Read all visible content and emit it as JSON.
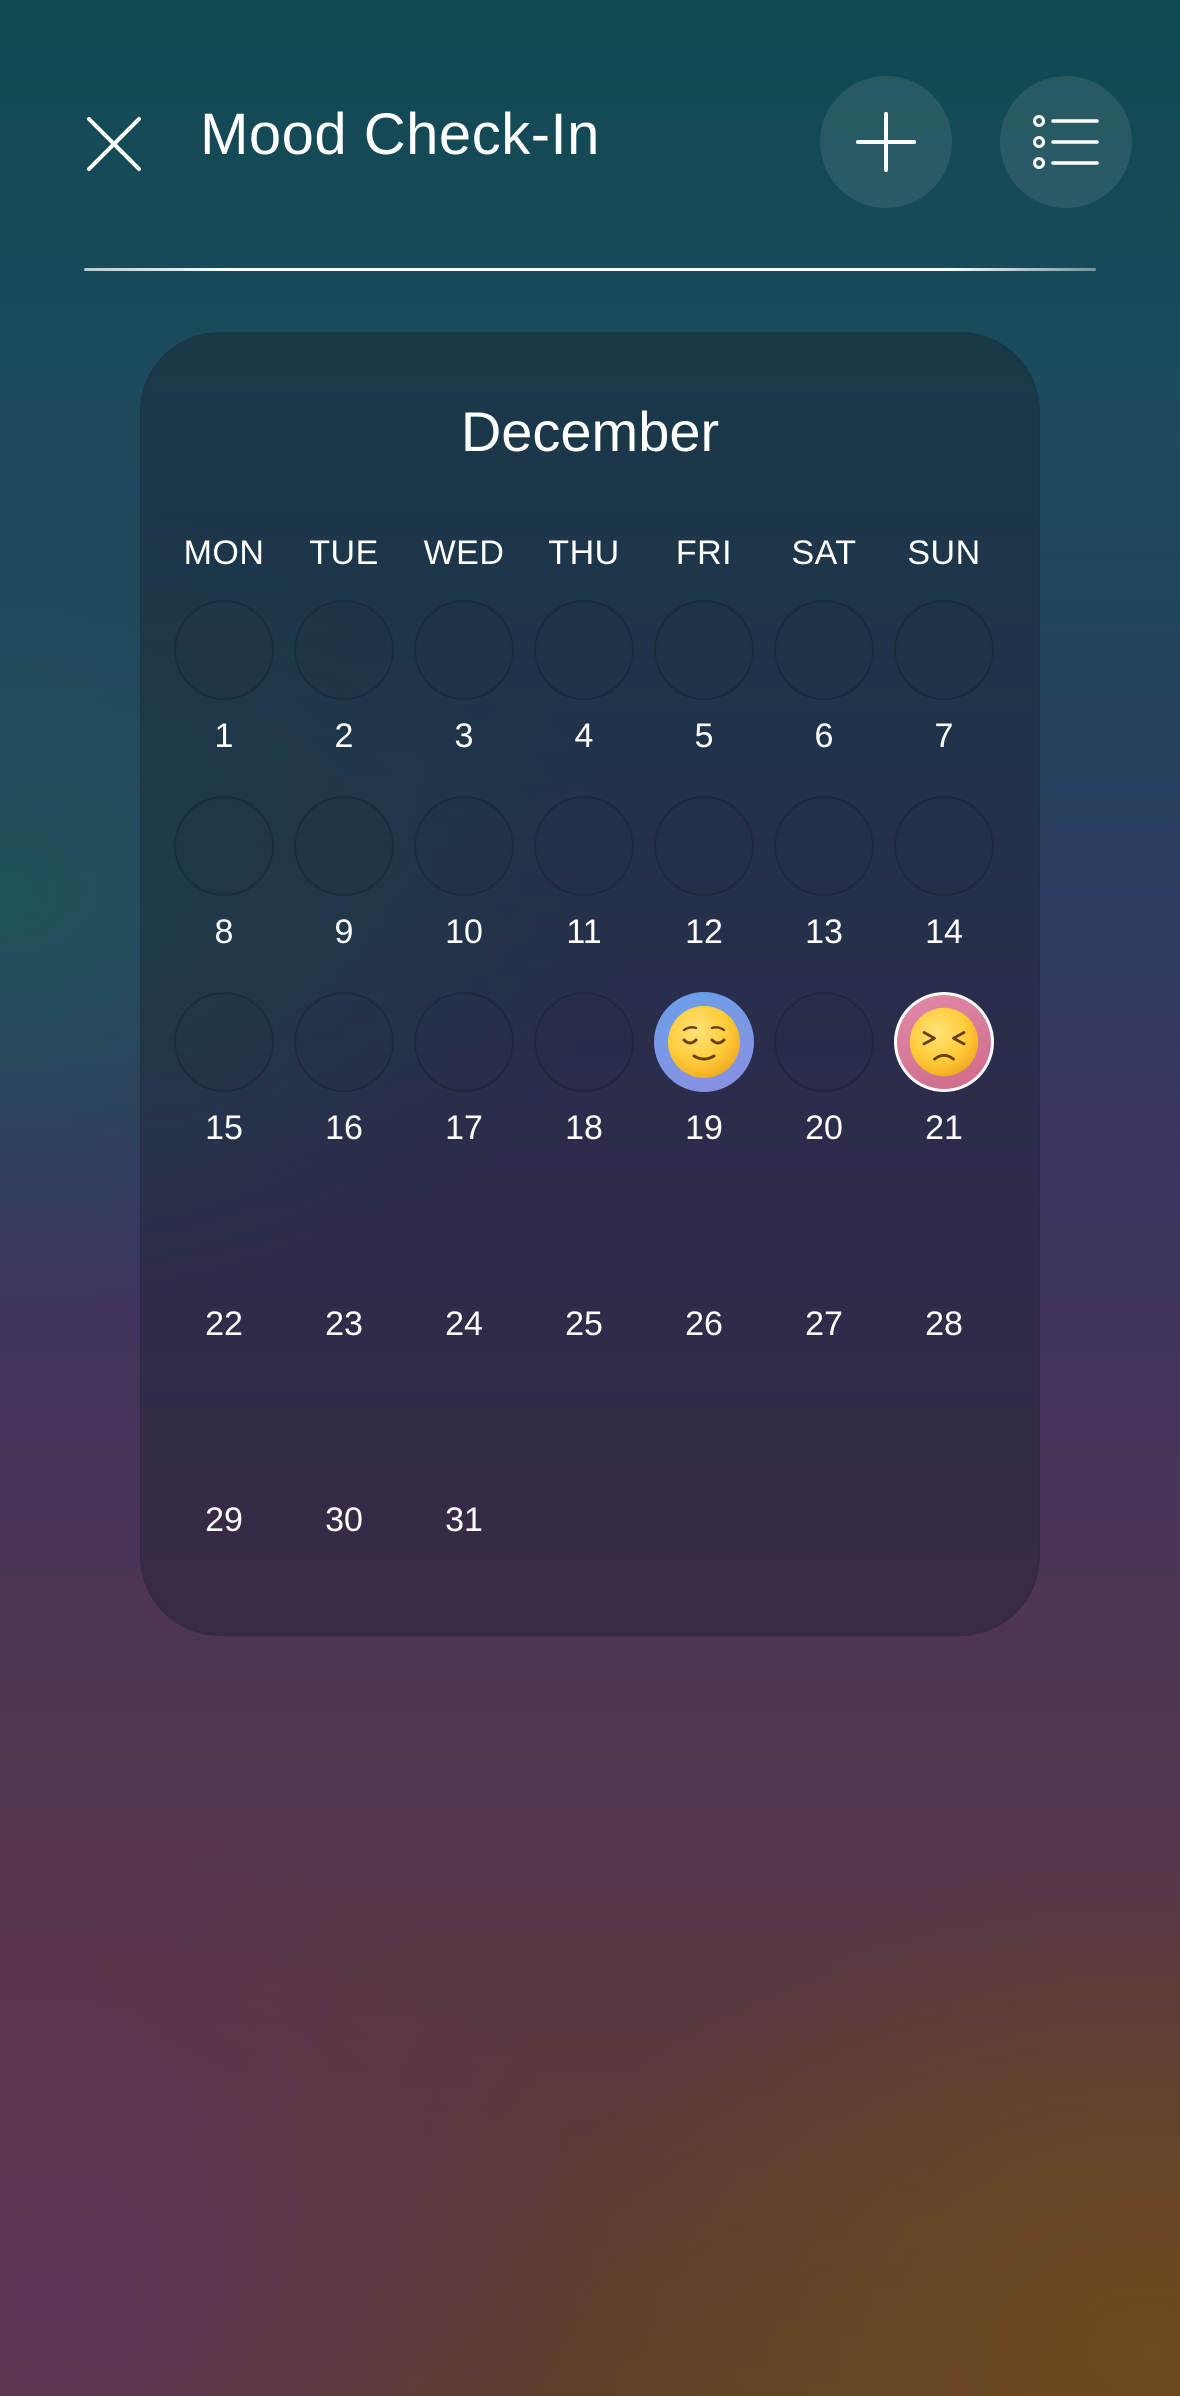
{
  "header": {
    "title": "Mood Check-In",
    "close_icon": "close-icon",
    "add_icon": "plus-icon",
    "list_icon": "list-icon"
  },
  "calendar": {
    "month": "December",
    "weekdays": [
      "MON",
      "TUE",
      "WED",
      "THU",
      "FRI",
      "SAT",
      "SUN"
    ],
    "days": [
      "1",
      "2",
      "3",
      "4",
      "5",
      "6",
      "7",
      "8",
      "9",
      "10",
      "11",
      "12",
      "13",
      "14",
      "15",
      "16",
      "17",
      "18",
      "19",
      "20",
      "21",
      "22",
      "23",
      "24",
      "25",
      "26",
      "27",
      "28",
      "29",
      "30",
      "31"
    ],
    "moods": {
      "19": {
        "icon": "relieved-face-icon",
        "color": "#7a97e6"
      },
      "21": {
        "icon": "persevering-face-icon",
        "color": "#d97a99"
      }
    }
  }
}
